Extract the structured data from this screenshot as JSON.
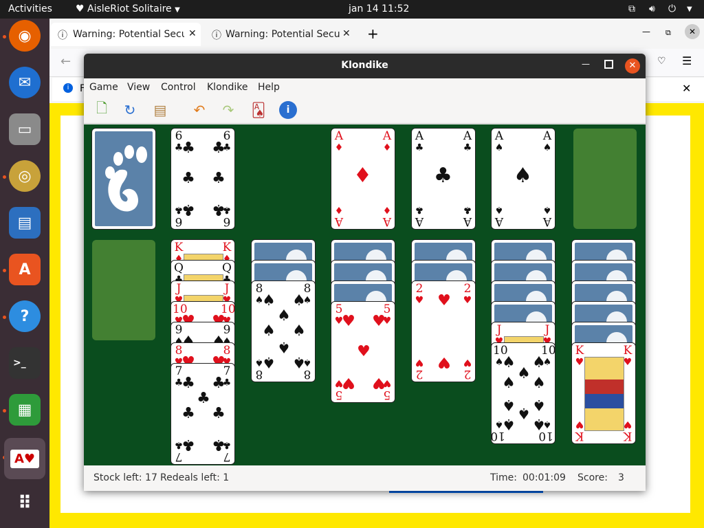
{
  "top_bar": {
    "activities": "Activities",
    "app_menu": "AisleRiot Solitaire",
    "clock": "jan 14  11:52"
  },
  "browser": {
    "tabs": [
      {
        "title": "Warning: Potential Securi"
      },
      {
        "title": "Warning: Potential Securi"
      }
    ],
    "notification_text": "F"
  },
  "window": {
    "title": "Klondike",
    "menu": [
      "Game",
      "View",
      "Control",
      "Klondike",
      "Help"
    ],
    "toolbar_icons": [
      "new-game-icon",
      "restart-icon",
      "select-game-icon",
      "undo-icon",
      "redo-icon",
      "hint-icon",
      "info-icon"
    ]
  },
  "board": {
    "waste_card": {
      "rank": "6",
      "suit": "♣"
    },
    "foundations": [
      {
        "rank": "A",
        "suit": "♦"
      },
      {
        "rank": "A",
        "suit": "♣"
      },
      {
        "rank": "A",
        "suit": "♠"
      }
    ],
    "tableau": [
      {
        "face_down": 0,
        "face_up": []
      },
      {
        "face_down": 0,
        "face_up": [
          {
            "rank": "K",
            "suit": "♦"
          },
          {
            "rank": "Q",
            "suit": "♣"
          },
          {
            "rank": "J",
            "suit": "♥"
          },
          {
            "rank": "10",
            "suit": "♥"
          },
          {
            "rank": "9",
            "suit": "♠"
          },
          {
            "rank": "8",
            "suit": "♥"
          },
          {
            "rank": "7",
            "suit": "♣"
          }
        ]
      },
      {
        "face_down": 2,
        "face_up": [
          {
            "rank": "8",
            "suit": "♠"
          }
        ]
      },
      {
        "face_down": 3,
        "face_up": [
          {
            "rank": "5",
            "suit": "♥"
          }
        ]
      },
      {
        "face_down": 2,
        "face_up": [
          {
            "rank": "2",
            "suit": "♥"
          }
        ]
      },
      {
        "face_down": 4,
        "face_up": [
          {
            "rank": "J",
            "suit": "♥"
          },
          {
            "rank": "10",
            "suit": "♠"
          }
        ]
      },
      {
        "face_down": 5,
        "face_up": [
          {
            "rank": "K",
            "suit": "♥"
          }
        ]
      }
    ]
  },
  "status": {
    "stock": "Stock left: 17",
    "redeals": "Redeals left: 1",
    "time_label": "Time:",
    "time_value": "00:01:09",
    "score_label": "Score:",
    "score_value": "3"
  }
}
